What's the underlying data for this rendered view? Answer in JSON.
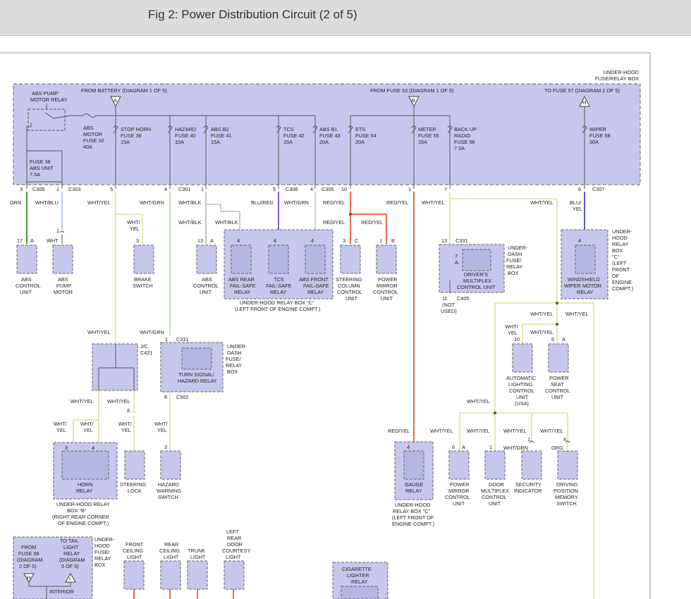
{
  "title": "Fig 2: Power Distribution Circuit (2 of 5)",
  "colors": {
    "box_fill": "#c7c7ee",
    "wire_grn": "#3aa02c",
    "wire_blu": "#2222aa",
    "wire_red": "#e23a10",
    "wire_yel": "#dede9a",
    "wire_blk": "#8a8a8a",
    "wire_gry": "#bbbbbb",
    "wire_purple": "#5a2ab0",
    "wire_wht_blu": "#a6b4e0",
    "wire_wht_grn": "#a8d6a0"
  },
  "fuse_box": {
    "label": [
      "UNDER-HOOD",
      "FUSE/RELAY BOX"
    ],
    "from_battery": "FROM BATTERY (DIAGRAM 1 OF 5)",
    "from_fuse53": "FROM FUSE 53 (DIAGRAM 1 OF 5)",
    "to_fuse57": "TO FUSE 57 (DIAGRAM 2 OF 5)",
    "tri_a": "A",
    "tri_b": "B",
    "tri_h": "H",
    "abs_relay": [
      "ABS PUMP",
      "MOTOR RELAY"
    ],
    "abs_motor_fuse": [
      "ABS",
      "MOTOR",
      "FUSE 32",
      "40A"
    ],
    "fuse38": [
      "FUSE 38",
      "ABS UNIT",
      "7.5A"
    ],
    "fuses": [
      {
        "lines": [
          "STOP HORN",
          "FUSE 39",
          "15A"
        ]
      },
      {
        "lines": [
          "HAZARD",
          "FUSE 40",
          "10A"
        ]
      },
      {
        "lines": [
          "ABS B2",
          "FUSE 41",
          "15A"
        ]
      },
      {
        "lines": [
          "TCS",
          "FUSE 42",
          "15A"
        ]
      },
      {
        "lines": [
          "ABS B1",
          "FUSE 43",
          "20A"
        ]
      },
      {
        "lines": [
          "ETS",
          "FUSE 54",
          "20A"
        ]
      },
      {
        "lines": [
          "METER",
          "FUSE 55",
          "15A"
        ]
      },
      {
        "lines": [
          "BACK UP",
          "RADIO",
          "FUSE 56",
          "7.5A"
        ]
      },
      {
        "lines": [
          "WIPER",
          "FUSE 58",
          "30A"
        ]
      }
    ]
  },
  "pins": [
    {
      "num": "3",
      "conn": "C305"
    },
    {
      "num": "1",
      "conn": "C303"
    },
    {
      "num": "5",
      "conn": ""
    },
    {
      "num": "4",
      "conn": "C301"
    },
    {
      "num": "1",
      "conn": ""
    },
    {
      "num": "5",
      "conn": "C306"
    },
    {
      "num": "4",
      "conn": "C305"
    },
    {
      "num": "10",
      "conn": ""
    },
    {
      "num": "1",
      "conn": ""
    },
    {
      "num": "7",
      "conn": ""
    },
    {
      "num": "6",
      "conn": "C307"
    }
  ],
  "wires": {
    "grn": "GRN",
    "wht_blu": "WHT/BLU",
    "wht_yel": "WHT/YEL",
    "wht_grn": "WHT/GRN",
    "wht_blk": "WHT/BLK",
    "blu_red": "BLU/RED",
    "red_yel": "RED/YEL",
    "blu_yel": [
      "BLU/",
      "YEL"
    ],
    "wht": "WHT",
    "wht_yel_2": [
      "WHT/",
      "YEL"
    ],
    "org": "ORG"
  },
  "components": {
    "abs_control": [
      "ABS",
      "CONTROL",
      "UNIT"
    ],
    "abs_pump": [
      "ABS",
      "PUMP",
      "MOTOR"
    ],
    "brake": [
      "BRAKE",
      "SWITCH"
    ],
    "abs_control2": [
      "ABS",
      "CONTROL",
      "UNIT"
    ],
    "abs_rear": [
      "ABS REAR",
      "FAIL-SAFE",
      "RELAY"
    ],
    "tcs": [
      "TCS",
      "FAIL-SAFE",
      "RELAY"
    ],
    "abs_front": [
      "ABS FRONT",
      "FAIL-SAFE",
      "RELAY"
    ],
    "steering_col": [
      "STEERING",
      "COLUMN",
      "CONTROL",
      "UNIT"
    ],
    "power_mirror": [
      "POWER",
      "MIRROR",
      "CONTROL",
      "UNIT"
    ],
    "relay_box_c": [
      "UNDER-HOOD RELAY BOX \"C\"",
      "(LEFT FRONT OF ENGINE COMPT.)"
    ],
    "drivers_mux": [
      "DRIVER'S",
      "MULTIPLEX",
      "CONTROL UNIT"
    ],
    "under_dash_box": [
      "UNDER-",
      "DASH",
      "FUSE/",
      "RELAY",
      "BOX"
    ],
    "not_used": [
      "11",
      "(NOT",
      "USED)"
    ],
    "c405": "C405",
    "c331": "C331",
    "wiper_relay": [
      "WINDSHIELD",
      "WIPER MOTOR",
      "RELAY"
    ],
    "wiper_box": [
      "UNDER-",
      "HOOD",
      "RELAY",
      "BOX",
      "\"C\"",
      "(LEFT",
      "FRONT",
      "OF",
      "ENGINE",
      "COMPT.)"
    ],
    "jc": [
      "J/C",
      "C421"
    ],
    "turn_signal": [
      "TURN SIGNAL/",
      "HAZARD RELAY"
    ],
    "under_dash_box2": [
      "UNDER-",
      "DASH",
      "FUSE/",
      "RELAY",
      "BOX"
    ],
    "c502": "C502",
    "auto_light": [
      "AUTOMATIC",
      "LIGHTING",
      "CONTROL",
      "UNIT",
      "(USA)"
    ],
    "power_seat": [
      "POWER",
      "SEAT",
      "CONTROL",
      "UNIT"
    ],
    "horn_relay": [
      "HORN",
      "RELAY"
    ],
    "horn_box": [
      "UNDER-HOOD RELAY",
      "BOX \"B\"",
      "(RIGHT REAR CORNER",
      "OF ENGINE COMPT.)"
    ],
    "steering_lock": [
      "STEERING",
      "LOCK"
    ],
    "hazard_switch": [
      "HAZARD",
      "WARNING",
      "SWITCH"
    ],
    "gauge_relay": [
      "GAUGE",
      "RELAY"
    ],
    "gauge_box": [
      "UNDER-HOOD",
      "RELAY BOX \"C\"",
      "(LEFT FRONT OF",
      "ENGINE COMPT.)"
    ],
    "pm_control": [
      "POWER",
      "MIRROR",
      "CONTROL",
      "UNIT"
    ],
    "door_mux": [
      "DOOR",
      "MULTIPLEX",
      "CONTROL",
      "UNIT"
    ],
    "security": [
      "SECURITY",
      "INDICATOR"
    ],
    "driving_pos": [
      "DRIVING",
      "POSITION",
      "MEMORY",
      "SWITCH"
    ],
    "from_fuse58": [
      "FROM",
      "FUSE 58",
      "(DIAGRAM",
      "2 OF 5)"
    ],
    "to_tail": [
      "TO TAIL",
      "LIGHT",
      "RELAY",
      "(DIAGRAM",
      "5 OF 5)"
    ],
    "under_hood_box3": [
      "UNDER-",
      "HOOD",
      "FUSE/",
      "RELAY",
      "BOX"
    ],
    "interior": "INTERIOR",
    "front_ceiling": [
      "FRONT",
      "CEILING",
      "LIGHT"
    ],
    "rear_ceiling": [
      "REAR",
      "CEILING",
      "LIGHT"
    ],
    "trunk": [
      "TRUNK",
      "LIGHT"
    ],
    "left_rear_door": [
      "LEFT",
      "REAR",
      "DOOR",
      "COURTESY",
      "LIGHT"
    ],
    "cig_lighter": [
      "CIGARETTE",
      "LIGHTER",
      "RELAY"
    ]
  }
}
